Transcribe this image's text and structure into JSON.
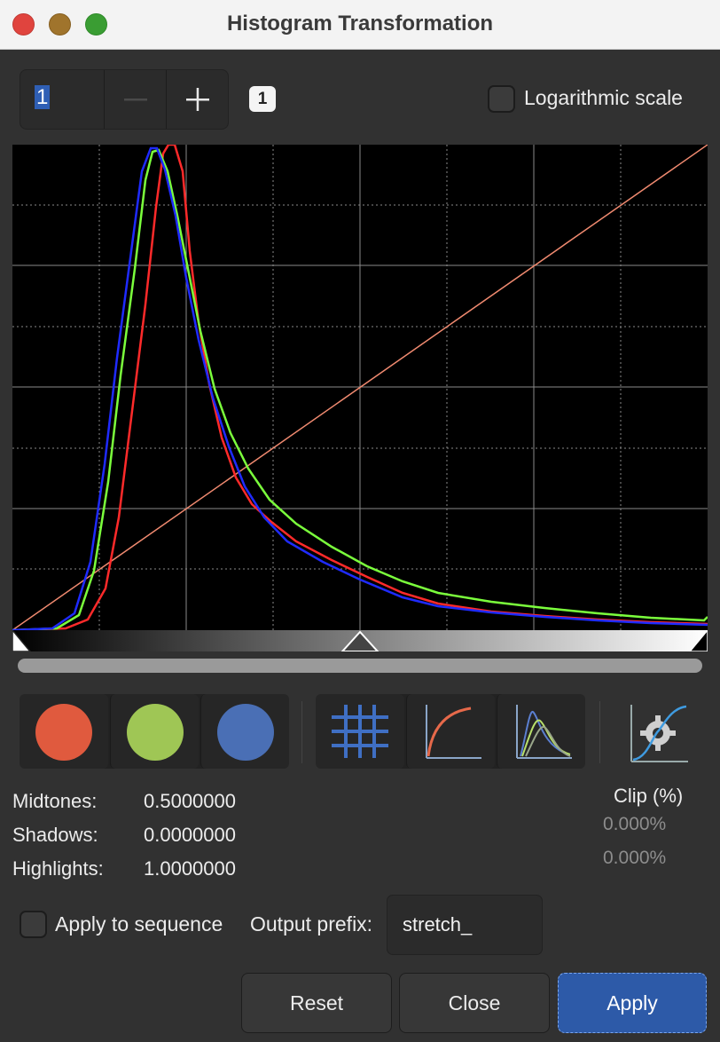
{
  "window": {
    "title": "Histogram Transformation"
  },
  "toolbar": {
    "zoom_value": "1",
    "zoom_minus_icon": "minus-icon",
    "zoom_plus_icon": "plus-icon",
    "zoom_badge": "1",
    "log_scale_label": "Logarithmic scale",
    "log_scale_checked": false
  },
  "histogram": {
    "channels": [
      "red",
      "green",
      "blue"
    ],
    "colors": {
      "red": "#ff2a2a",
      "green": "#7bff3c",
      "blue": "#1f2bff",
      "transfer_curve": "#f08a70"
    },
    "grid": true,
    "cursors": {
      "shadows": 0.0,
      "midtones": 0.5,
      "highlights": 1.0
    }
  },
  "channel_buttons": [
    {
      "name": "red-channel",
      "color": "#e05a3e"
    },
    {
      "name": "green-channel",
      "color": "#9fc655"
    },
    {
      "name": "blue-channel",
      "color": "#4a6fb5"
    }
  ],
  "display_buttons": [
    {
      "name": "grid",
      "icon": "grid-icon"
    },
    {
      "name": "curve",
      "icon": "curve-icon"
    },
    {
      "name": "histogram-overlay",
      "icon": "histogram-overlay-icon"
    }
  ],
  "auto_stretch_icon": "auto-stretch-gear-icon",
  "params": {
    "midtones_label": "Midtones:",
    "midtones_value": "0.5000000",
    "shadows_label": "Shadows:",
    "shadows_value": "0.0000000",
    "highlights_label": "Highlights:",
    "highlights_value": "1.0000000",
    "clip_title": "Clip (%)",
    "clip_low": "0.000%",
    "clip_high": "0.000%"
  },
  "sequence": {
    "apply_label": "Apply to sequence",
    "apply_checked": false,
    "prefix_label": "Output prefix:",
    "prefix_value": "stretch_"
  },
  "buttons": {
    "reset": "Reset",
    "close": "Close",
    "apply": "Apply"
  }
}
